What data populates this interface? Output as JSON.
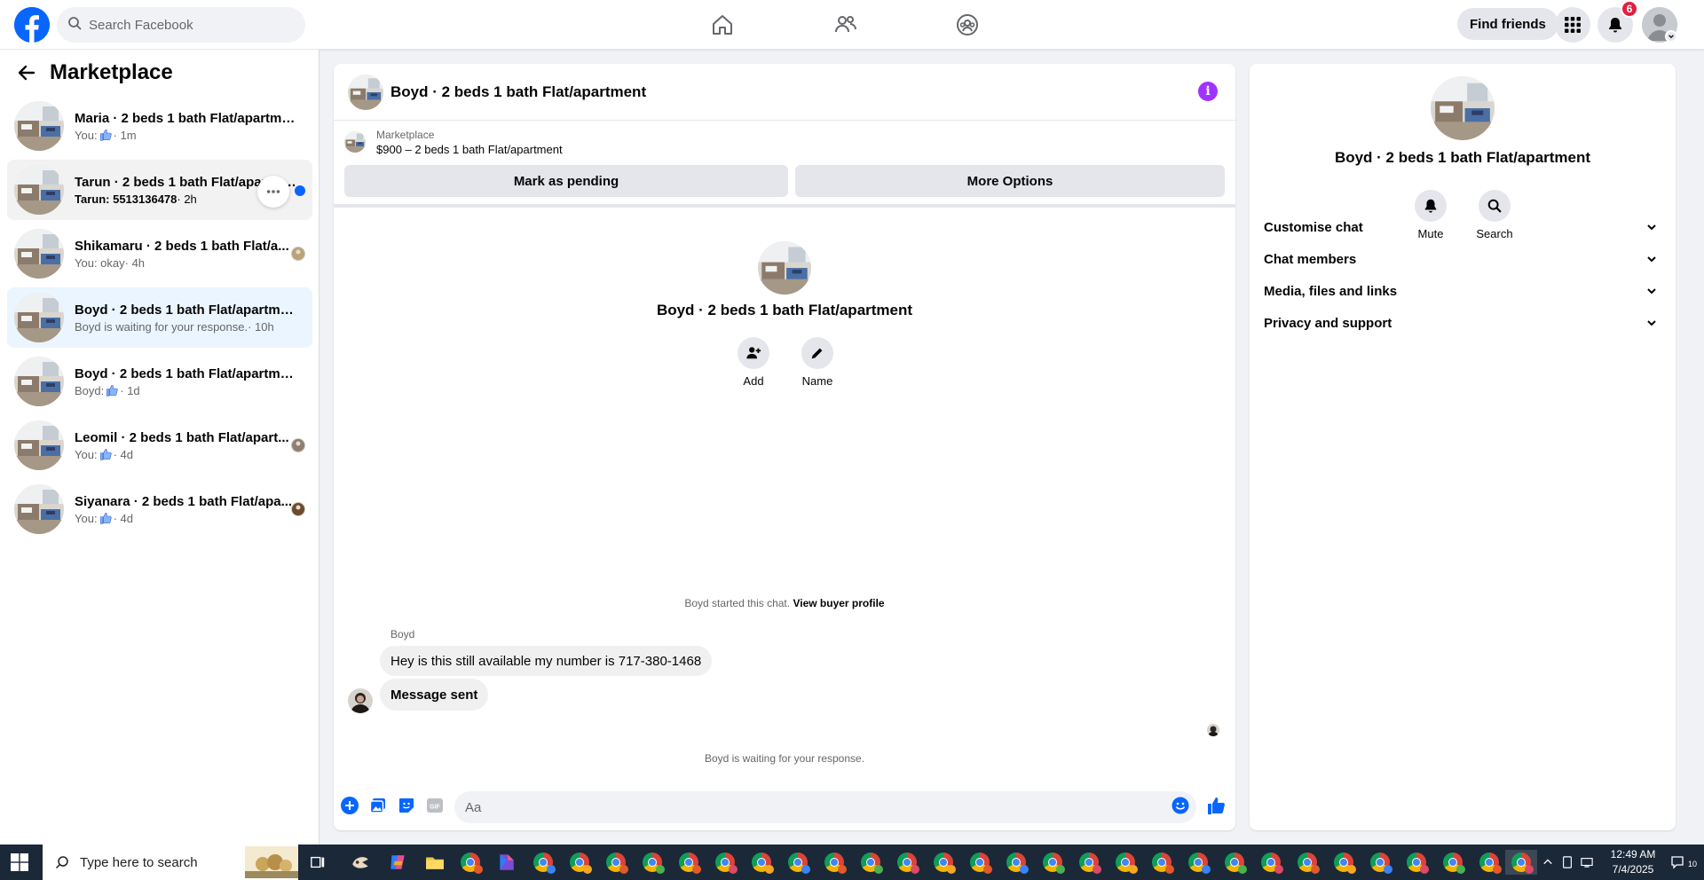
{
  "topbar": {
    "search_placeholder": "Search Facebook",
    "find_friends": "Find friends",
    "notification_count": "6",
    "brand_color": "#0866ff",
    "nav_icons": [
      "home-icon",
      "friends-icon",
      "groups-icon"
    ]
  },
  "sidebar": {
    "title": "Marketplace",
    "conversations": [
      {
        "title": "Maria · 2 beds 1 bath Flat/apartment",
        "prefix": "You:",
        "like": true,
        "text": "",
        "time": "· 1m",
        "state": "normal",
        "right": "none"
      },
      {
        "title": "Tarun · 2 beds 1 bath Flat/apartment",
        "prefix": "Tarun: 5513136478",
        "like": false,
        "text": "",
        "time": "· 2h",
        "state": "hovered",
        "right": "unread-dot"
      },
      {
        "title": "Shikamaru · 2 beds 1 bath Flat/a...",
        "prefix": "You: okay",
        "like": false,
        "text": "",
        "time": "· 4h",
        "state": "normal",
        "right": "avatar"
      },
      {
        "title": "Boyd · 2 beds 1 bath Flat/apartment",
        "prefix": "Boyd is waiting for your response.",
        "like": false,
        "text": "",
        "time": "· 10h",
        "state": "selected",
        "right": "none"
      },
      {
        "title": "Boyd · 2 beds 1 bath Flat/apartment",
        "prefix": "Boyd:",
        "like": true,
        "text": "",
        "time": "· 1d",
        "state": "normal",
        "right": "none"
      },
      {
        "title": "Leomil · 2 beds 1 bath Flat/apart...",
        "prefix": "You:",
        "like": true,
        "text": "",
        "time": "· 4d",
        "state": "normal",
        "right": "avatar"
      },
      {
        "title": "Siyanara · 2 beds 1 bath Flat/apa...",
        "prefix": "You:",
        "like": true,
        "text": "",
        "time": "· 4d",
        "state": "normal",
        "right": "avatar"
      }
    ]
  },
  "chat": {
    "header_title": "Boyd · 2 beds 1 bath Flat/apartment",
    "listing_source": "Marketplace",
    "listing_price": "$900 – 2 beds 1 bath Flat/apartment",
    "mark_pending": "Mark as pending",
    "more_options": "More Options",
    "center_title": "Boyd · 2 beds 1 bath Flat/apartment",
    "add_label": "Add",
    "name_label": "Name",
    "started_text": "Boyd started this chat.",
    "view_profile": "View buyer profile",
    "sender": "Boyd",
    "messages": [
      "Hey is this still available my number is 717-380-1468",
      "Message sent"
    ],
    "waiting_text": "Boyd is waiting for your response.",
    "composer_placeholder": "Aa",
    "accent_color": "#0866ff"
  },
  "right_panel": {
    "title": "Boyd · 2 beds 1 bath Flat/apartment",
    "mute_label": "Mute",
    "search_label": "Search",
    "sections": [
      "Customise chat",
      "Chat members",
      "Media, files and links",
      "Privacy and support"
    ]
  },
  "taskbar": {
    "search_placeholder": "Type here to search",
    "time": "12:49 AM",
    "date": "7/4/2025",
    "notification_count": "10"
  }
}
